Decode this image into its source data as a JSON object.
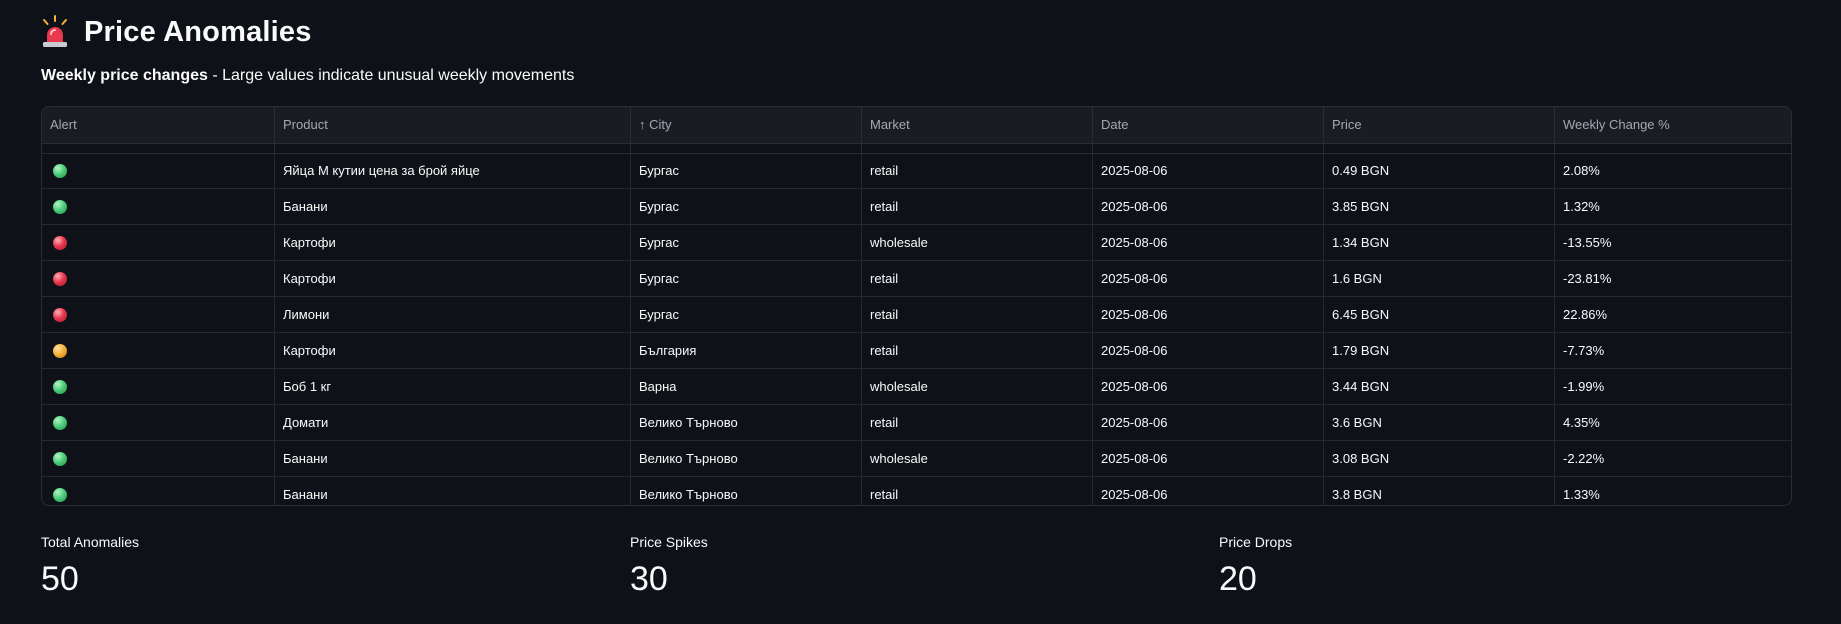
{
  "header": {
    "title": "Price Anomalies",
    "icon": "siren-icon",
    "subtitle_bold": "Weekly price changes",
    "subtitle_rest": " - Large values indicate unusual weekly movements"
  },
  "table": {
    "columns": [
      "Alert",
      "Product",
      "↑ City",
      "Market",
      "Date",
      "Price",
      "Weekly Change %"
    ],
    "rows": [
      {
        "alert": "green",
        "product": "Яйца М кутии цена за брой яйце",
        "city": "Бургас",
        "market": "retail",
        "date": "2025-08-06",
        "price": "0.49 BGN",
        "change": "2.08%"
      },
      {
        "alert": "green",
        "product": "Банани",
        "city": "Бургас",
        "market": "retail",
        "date": "2025-08-06",
        "price": "3.85 BGN",
        "change": "1.32%"
      },
      {
        "alert": "red",
        "product": "Картофи",
        "city": "Бургас",
        "market": "wholesale",
        "date": "2025-08-06",
        "price": "1.34 BGN",
        "change": "-13.55%"
      },
      {
        "alert": "red",
        "product": "Картофи",
        "city": "Бургас",
        "market": "retail",
        "date": "2025-08-06",
        "price": "1.6 BGN",
        "change": "-23.81%"
      },
      {
        "alert": "red",
        "product": "Лимони",
        "city": "Бургас",
        "market": "retail",
        "date": "2025-08-06",
        "price": "6.45 BGN",
        "change": "22.86%"
      },
      {
        "alert": "orange",
        "product": "Картофи",
        "city": "България",
        "market": "retail",
        "date": "2025-08-06",
        "price": "1.79 BGN",
        "change": "-7.73%"
      },
      {
        "alert": "green",
        "product": "Боб 1 кг",
        "city": "Варна",
        "market": "wholesale",
        "date": "2025-08-06",
        "price": "3.44 BGN",
        "change": "-1.99%"
      },
      {
        "alert": "green",
        "product": "Домати",
        "city": "Велико Търново",
        "market": "retail",
        "date": "2025-08-06",
        "price": "3.6 BGN",
        "change": "4.35%"
      },
      {
        "alert": "green",
        "product": "Банани",
        "city": "Велико Търново",
        "market": "wholesale",
        "date": "2025-08-06",
        "price": "3.08 BGN",
        "change": "-2.22%"
      },
      {
        "alert": "green",
        "product": "Банани",
        "city": "Велико Търново",
        "market": "retail",
        "date": "2025-08-06",
        "price": "3.8 BGN",
        "change": "1.33%"
      }
    ]
  },
  "metrics": [
    {
      "label": "Total Anomalies",
      "value": "50"
    },
    {
      "label": "Price Spikes",
      "value": "30"
    },
    {
      "label": "Price Drops",
      "value": "20"
    }
  ],
  "colors": {
    "background": "#0e1117",
    "green": "#4ccf7c",
    "red": "#e8394e",
    "orange": "#f4b33b"
  }
}
